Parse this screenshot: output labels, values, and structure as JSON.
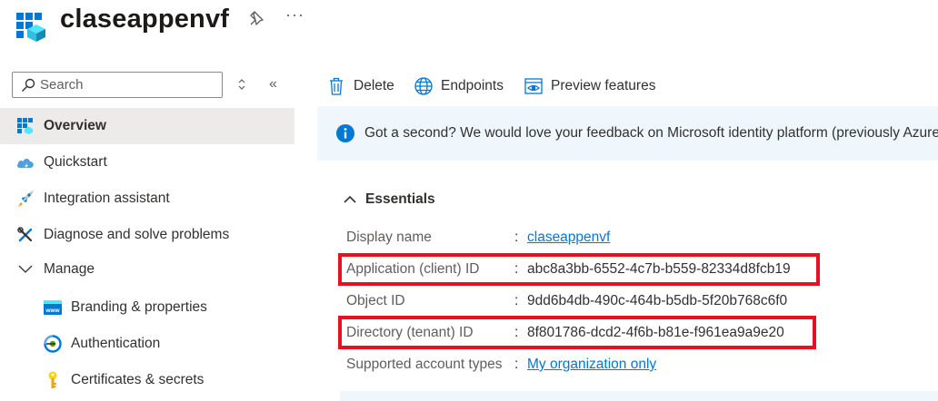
{
  "header": {
    "title": "claseappenvf",
    "more_label": "···"
  },
  "sidebar": {
    "search": {
      "placeholder": "Search",
      "value": ""
    },
    "collapse_label": "«",
    "items": [
      {
        "label": "Overview",
        "icon": "overview-grid-icon",
        "active": true
      },
      {
        "label": "Quickstart",
        "icon": "cloud-quickstart-icon"
      },
      {
        "label": "Integration assistant",
        "icon": "rocket-icon"
      },
      {
        "label": "Diagnose and solve problems",
        "icon": "wrench-icon"
      },
      {
        "label": "Manage",
        "icon": "chevron-down-icon"
      },
      {
        "label": "Branding & properties",
        "icon": "www-icon"
      },
      {
        "label": "Authentication",
        "icon": "authentication-icon"
      },
      {
        "label": "Certificates & secrets",
        "icon": "key-icon"
      }
    ]
  },
  "toolbar": {
    "delete_label": "Delete",
    "endpoints_label": "Endpoints",
    "preview_label": "Preview features"
  },
  "banner": {
    "text": "Got a second? We would love your feedback on Microsoft identity platform (previously Azure AD"
  },
  "essentials": {
    "heading": "Essentials",
    "rows": [
      {
        "label": "Display name",
        "colon": ":",
        "value": "claseappenvf",
        "link": true
      },
      {
        "label": "Application (client) ID",
        "colon": ":",
        "value": "abc8a3bb-6552-4c7b-b559-82334d8fcb19",
        "highlighted": true
      },
      {
        "label": "Object ID",
        "colon": ":",
        "value": "9dd6b4db-490c-464b-b5db-5f20b768c6f0"
      },
      {
        "label": "Directory (tenant) ID",
        "colon": ":",
        "value": "8f801786-dcd2-4f6b-b81e-f961ea9a9e20",
        "highlighted": true
      },
      {
        "label": "Supported account types",
        "colon": ":",
        "value": "My organization only",
        "link": true
      }
    ]
  },
  "colors": {
    "accent": "#0078d4",
    "highlight_border": "#e81123",
    "banner_bg": "#eff6fc",
    "active_nav_bg": "#edebe9"
  }
}
